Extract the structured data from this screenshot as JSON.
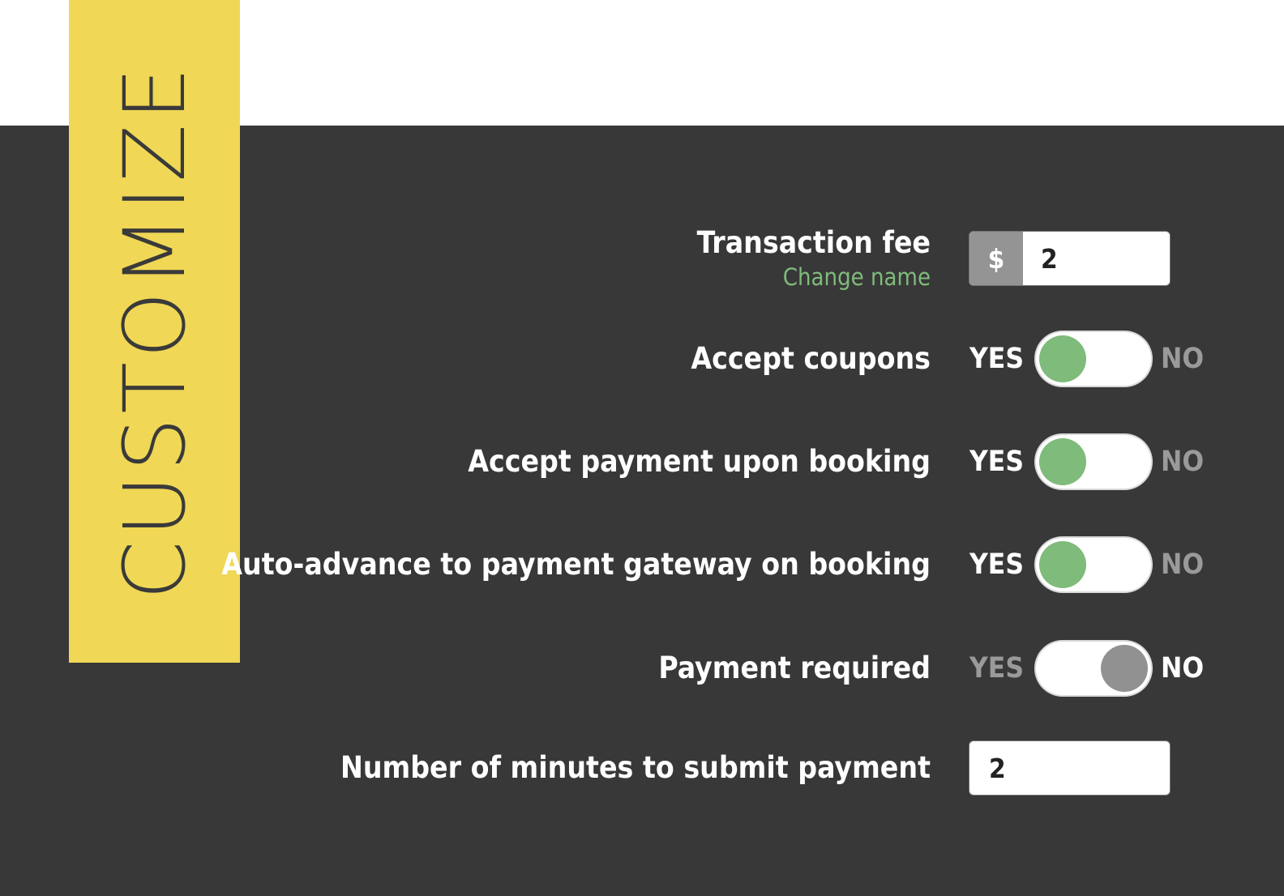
{
  "banner": {
    "title": "CUSTOMIZE",
    "color": "#f0d755"
  },
  "theme": {
    "background_dark": "#383838",
    "background_light": "#ffffff",
    "accent_green": "#7fbb7b",
    "muted_gray": "#9a9a9a",
    "prefix_gray": "#949494"
  },
  "form": {
    "transaction_fee": {
      "label": "Transaction fee",
      "change_name_link": "Change name",
      "currency_symbol": "$",
      "value": "2",
      "placeholder": ""
    },
    "toggles": [
      {
        "label": "Accept coupons",
        "yes_label": "YES",
        "no_label": "NO",
        "state": "yes"
      },
      {
        "label": "Accept payment upon booking",
        "yes_label": "YES",
        "no_label": "NO",
        "state": "yes"
      },
      {
        "label": "Auto-advance to payment gateway on booking",
        "yes_label": "YES",
        "no_label": "NO",
        "state": "yes"
      },
      {
        "label": "Payment required",
        "yes_label": "YES",
        "no_label": "NO",
        "state": "no"
      }
    ],
    "minutes_to_submit": {
      "label": "Number of minutes to submit payment",
      "value": "2",
      "placeholder": ""
    }
  }
}
